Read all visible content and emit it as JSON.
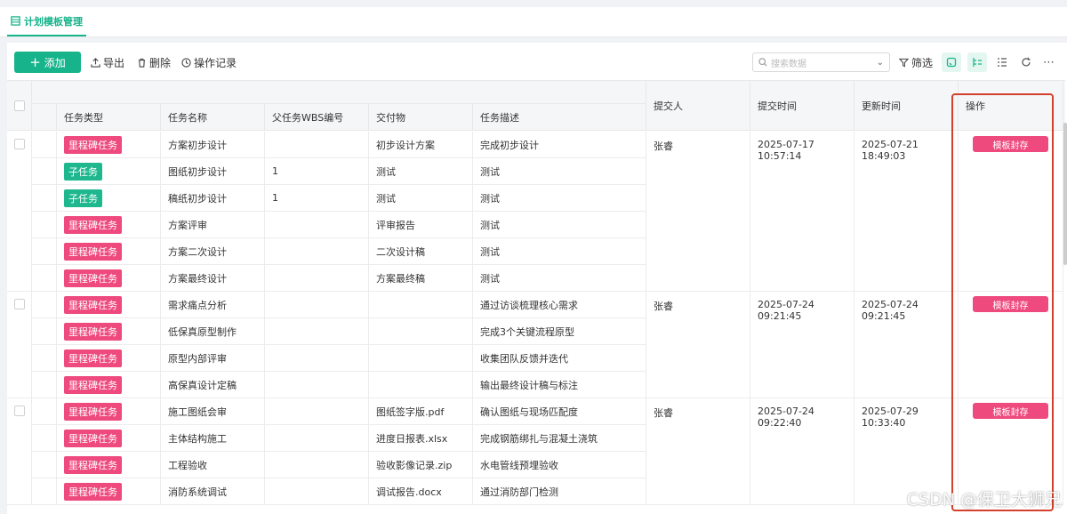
{
  "tab": {
    "label": "计划模板管理"
  },
  "toolbar": {
    "add_label": "添加",
    "export_label": "导出",
    "delete_label": "删除",
    "log_label": "操作记录",
    "search_placeholder": "搜索数据",
    "filter_label": "筛选"
  },
  "table": {
    "headers": {
      "task_type": "任务类型",
      "task_name": "任务名称",
      "parent_wbs": "父任务WBS编号",
      "deliverable": "交付物",
      "description": "任务描述",
      "submitter": "提交人",
      "submit_time": "提交时间",
      "update_time": "更新时间",
      "action": "操作"
    },
    "groups": [
      {
        "submitter": "张睿",
        "submit_time": "2025-07-17 10:57:14",
        "update_time": "2025-07-21 18:49:03",
        "action": "模板封存",
        "rows": [
          {
            "type": "里程碑任务",
            "kind": "milestone",
            "name": "方案初步设计",
            "wbs": "",
            "deliverable": "初步设计方案",
            "desc": "完成初步设计"
          },
          {
            "type": "子任务",
            "kind": "sub",
            "name": "图纸初步设计",
            "wbs": "1",
            "deliverable": "测试",
            "desc": "测试"
          },
          {
            "type": "子任务",
            "kind": "sub",
            "name": "稿纸初步设计",
            "wbs": "1",
            "deliverable": "测试",
            "desc": "测试"
          },
          {
            "type": "里程碑任务",
            "kind": "milestone",
            "name": "方案评审",
            "wbs": "",
            "deliverable": "评审报告",
            "desc": "测试"
          },
          {
            "type": "里程碑任务",
            "kind": "milestone",
            "name": "方案二次设计",
            "wbs": "",
            "deliverable": "二次设计稿",
            "desc": "测试"
          },
          {
            "type": "里程碑任务",
            "kind": "milestone",
            "name": "方案最终设计",
            "wbs": "",
            "deliverable": "方案最终稿",
            "desc": "测试"
          }
        ]
      },
      {
        "submitter": "张睿",
        "submit_time": "2025-07-24 09:21:45",
        "update_time": "2025-07-24 09:21:45",
        "action": "模板封存",
        "rows": [
          {
            "type": "里程碑任务",
            "kind": "milestone",
            "name": "需求痛点分析",
            "wbs": "",
            "deliverable": "",
            "desc": "通过访谈梳理核心需求"
          },
          {
            "type": "里程碑任务",
            "kind": "milestone",
            "name": "低保真原型制作",
            "wbs": "",
            "deliverable": "",
            "desc": "完成3个关键流程原型"
          },
          {
            "type": "里程碑任务",
            "kind": "milestone",
            "name": "原型内部评审",
            "wbs": "",
            "deliverable": "",
            "desc": "收集团队反馈并迭代"
          },
          {
            "type": "里程碑任务",
            "kind": "milestone",
            "name": "高保真设计定稿",
            "wbs": "",
            "deliverable": "",
            "desc": "输出最终设计稿与标注"
          }
        ]
      },
      {
        "submitter": "张睿",
        "submit_time": "2025-07-24 09:22:40",
        "update_time": "2025-07-29 10:33:40",
        "action": "模板封存",
        "rows": [
          {
            "type": "里程碑任务",
            "kind": "milestone",
            "name": "施工图纸会审",
            "wbs": "",
            "deliverable": "图纸签字版.pdf",
            "desc": "确认图纸与现场匹配度"
          },
          {
            "type": "里程碑任务",
            "kind": "milestone",
            "name": "主体结构施工",
            "wbs": "",
            "deliverable": "进度日报表.xlsx",
            "desc": "完成钢筋绑扎与混凝土浇筑"
          },
          {
            "type": "里程碑任务",
            "kind": "milestone",
            "name": "工程验收",
            "wbs": "",
            "deliverable": "验收影像记录.zip",
            "desc": "水电管线预埋验收"
          },
          {
            "type": "里程碑任务",
            "kind": "milestone",
            "name": "消防系统调试",
            "wbs": "",
            "deliverable": "调试报告.docx",
            "desc": "通过消防部门检测"
          }
        ]
      }
    ]
  },
  "watermark": "CSDN @保卫大狮兄",
  "colors": {
    "accent": "#17b38b",
    "milestone": "#ee4a7e",
    "highlight": "#d4402c"
  }
}
